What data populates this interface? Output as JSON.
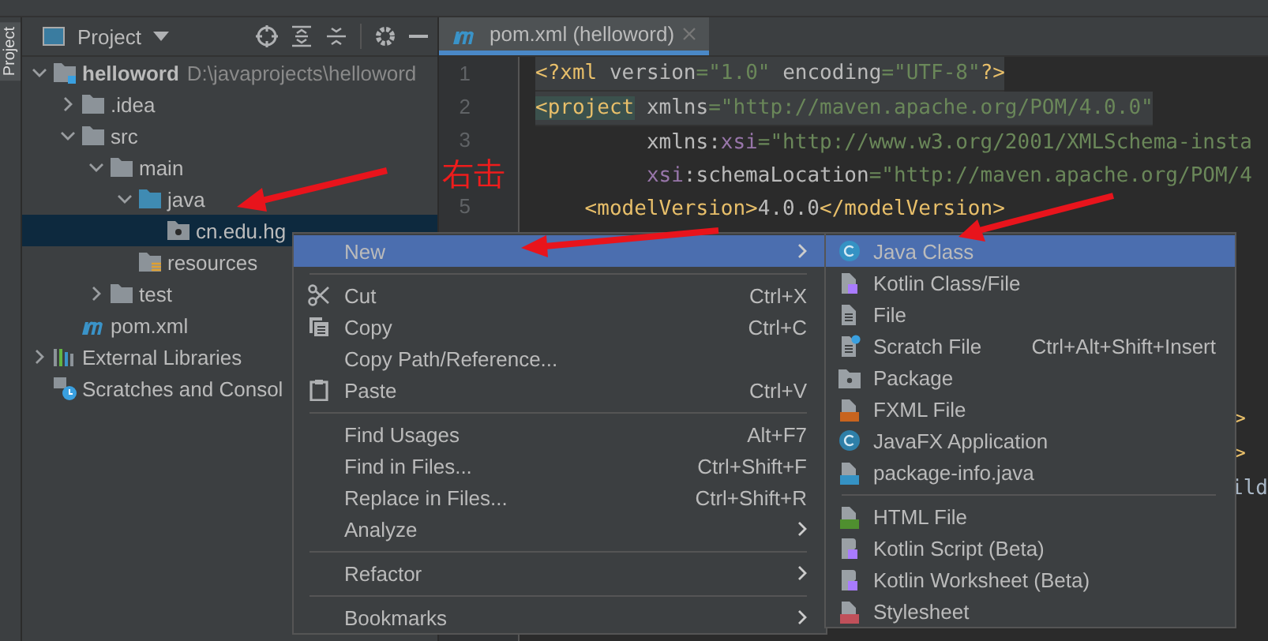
{
  "side_strip": {
    "label": "Project"
  },
  "project_panel": {
    "title": "Project"
  },
  "tree": [
    {
      "kind": "module",
      "name": "helloword",
      "path": "D:\\javaprojects\\helloword",
      "expanded": true,
      "selected": false,
      "children": [
        {
          "kind": "folder",
          "name": ".idea",
          "expanded": false,
          "selected": false
        },
        {
          "kind": "folder",
          "name": "src",
          "expanded": true,
          "selected": false,
          "children": [
            {
              "kind": "folder",
              "name": "main",
              "expanded": true,
              "selected": false,
              "children": [
                {
                  "kind": "source",
                  "name": "java",
                  "expanded": true,
                  "selected": false,
                  "children": [
                    {
                      "kind": "package",
                      "name": "cn.edu.hg",
                      "selected": true
                    }
                  ]
                },
                {
                  "kind": "resources",
                  "name": "resources",
                  "selected": false
                }
              ]
            },
            {
              "kind": "folder",
              "name": "test",
              "expanded": false,
              "selected": false
            }
          ]
        },
        {
          "kind": "maven",
          "name": "pom.xml",
          "selected": false
        }
      ]
    },
    {
      "kind": "libraries",
      "name": "External Libraries",
      "expanded": false,
      "selected": false
    },
    {
      "kind": "scratches",
      "name": "Scratches and Consol",
      "selected": false
    }
  ],
  "editor_tab": {
    "title": "pom.xml (helloword)",
    "selected": true
  },
  "code_lines": [
    {
      "number": "1",
      "kind": "top",
      "tokens": [
        {
          "text": "<?xml ",
          "kind": "tag"
        },
        {
          "text": "version",
          "kind": "attr"
        },
        {
          "text": "=\"1.0\" ",
          "kind": "value"
        },
        {
          "text": "encoding",
          "kind": "attr"
        },
        {
          "text": "=\"UTF-8\"",
          "kind": "value"
        },
        {
          "text": "?>",
          "kind": "tag"
        }
      ]
    },
    {
      "number": "2",
      "kind": "top",
      "tokens": [
        {
          "text": "<project",
          "kind": "tag_hl"
        },
        {
          "text": " xmlns",
          "kind": "attr"
        },
        {
          "text": "=\"http://maven.apache.org/POM/4.0.0\"",
          "kind": "value"
        }
      ]
    },
    {
      "number": "3",
      "kind": "continuation",
      "tokens": [
        {
          "text": "xmlns:",
          "kind": "attr"
        },
        {
          "text": "xsi",
          "kind": "ns"
        },
        {
          "text": "=\"http://www.w3.org/2001/XMLSchema-insta",
          "kind": "value"
        }
      ]
    },
    {
      "kind": "continuation",
      "tokens": [
        {
          "text": "xsi",
          "kind": "ns"
        },
        {
          "text": ":schemaLocation",
          "kind": "attr"
        },
        {
          "text": "=\"http://maven.apache.org/POM/4",
          "kind": "value"
        }
      ]
    },
    {
      "number": "5",
      "kind": "child",
      "tokens": [
        {
          "text": "<modelVersion>",
          "kind": "tag"
        },
        {
          "text": "4.0.0",
          "kind": "attr"
        },
        {
          "text": "</modelVersion>",
          "kind": "tag"
        }
      ]
    }
  ],
  "code_fragments": [
    {
      "text": ">"
    },
    {
      "text": ">"
    },
    {
      "text": "ild"
    }
  ],
  "context_menu": [
    {
      "kind": "plain",
      "label": "New",
      "submenu": true,
      "selected": true
    },
    {
      "kind": "separator"
    },
    {
      "kind": "cut",
      "label": "Cut",
      "shortcut": "Ctrl+X",
      "selected": false
    },
    {
      "kind": "copy",
      "label": "Copy",
      "shortcut": "Ctrl+C",
      "selected": false
    },
    {
      "kind": "plain",
      "label": "Copy Path/Reference...",
      "selected": false
    },
    {
      "kind": "paste",
      "label": "Paste",
      "shortcut": "Ctrl+V",
      "selected": false
    },
    {
      "kind": "separator"
    },
    {
      "kind": "plain",
      "label": "Find Usages",
      "shortcut": "Alt+F7",
      "selected": false
    },
    {
      "kind": "plain",
      "label": "Find in Files...",
      "shortcut": "Ctrl+Shift+F",
      "selected": false
    },
    {
      "kind": "plain",
      "label": "Replace in Files...",
      "shortcut": "Ctrl+Shift+R",
      "selected": false
    },
    {
      "kind": "plain",
      "label": "Analyze",
      "submenu": true,
      "selected": false
    },
    {
      "kind": "separator"
    },
    {
      "kind": "plain",
      "label": "Refactor",
      "submenu": true,
      "selected": false
    },
    {
      "kind": "separator"
    },
    {
      "kind": "plain",
      "label": "Bookmarks",
      "submenu": true,
      "selected": false
    }
  ],
  "new_submenu": [
    {
      "kind": "java_class",
      "label": "Java Class",
      "selected": true
    },
    {
      "kind": "kotlin_file",
      "label": "Kotlin Class/File",
      "selected": false
    },
    {
      "kind": "file",
      "label": "File",
      "selected": false
    },
    {
      "kind": "scratch",
      "label": "Scratch File",
      "shortcut": "Ctrl+Alt+Shift+Insert",
      "selected": false
    },
    {
      "kind": "package",
      "label": "Package",
      "selected": false
    },
    {
      "kind": "fxml",
      "label": "FXML File",
      "selected": false
    },
    {
      "kind": "javafx",
      "label": "JavaFX Application",
      "selected": false
    },
    {
      "kind": "java_file",
      "label": "package-info.java",
      "selected": false
    },
    {
      "kind": "separator"
    },
    {
      "kind": "html",
      "label": "HTML File",
      "selected": false
    },
    {
      "kind": "kotlin_script",
      "label": "Kotlin Script (Beta)",
      "selected": false
    },
    {
      "kind": "kotlin_script",
      "label": "Kotlin Worksheet (Beta)",
      "selected": false
    },
    {
      "kind": "css",
      "label": "Stylesheet",
      "selected": false
    }
  ],
  "annotation": {
    "text": "右击"
  }
}
